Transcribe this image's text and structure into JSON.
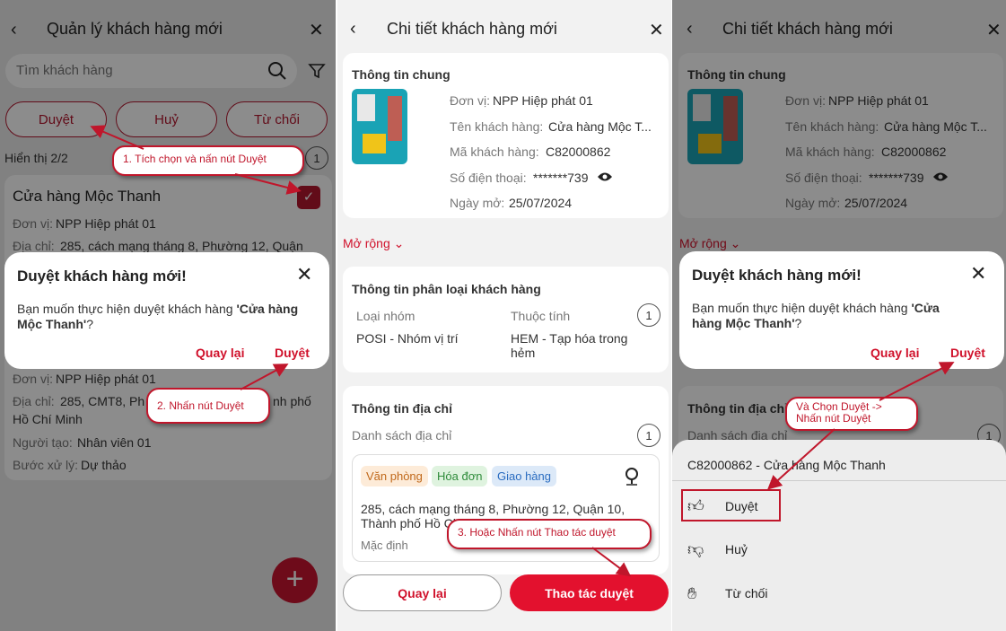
{
  "p1": {
    "title": "Quản lý khách hàng mới",
    "search_placeholder": "Tìm khách hàng",
    "filter_buttons": [
      "Duyệt",
      "Huỷ",
      "Từ chối"
    ],
    "showing": "Hiển thị 2/2",
    "showing_badge": "1",
    "customer_name": "Cửa hàng Mộc Thanh",
    "unit_label": "Đơn vị:",
    "unit_value": "NPP Hiệp phát 01",
    "address_label": "Địa chỉ:",
    "address_value": "285, cách mạng tháng 8, Phường 12, Quận",
    "unit2_label": "Đơn vị:",
    "unit2_value": "NPP Hiệp phát 01",
    "address2_label": "Địa chỉ:",
    "address2_value_a": "285, CMT8, Ph",
    "address2_value_b": "nh phố",
    "address2_value_c": "Hồ Chí Minh",
    "creator_label": "Người tạo:",
    "creator_value": "Nhân viên 01",
    "step_label": "Bước xử lý:",
    "step_value": "Dự thảo",
    "add_symbol": "+",
    "dialog": {
      "title": "Duyệt khách hàng mới!",
      "body_prefix": "Bạn muốn thực hiện duyệt khách hàng ",
      "body_name": "'Cửa hàng Mộc Thanh'",
      "body_suffix": "?",
      "back": "Quay lại",
      "approve": "Duyệt"
    },
    "callout1": "1. Tích chọn và nấn nút Duyệt",
    "callout2": "2. Nhấn nút Duyệt"
  },
  "p2": {
    "title": "Chi tiết khách hàng mới",
    "general_title": "Thông tin chung",
    "rows": [
      {
        "label": "Đơn vị:",
        "value": "NPP Hiệp phát 01"
      },
      {
        "label": "Tên khách hàng:",
        "value": "Cửa hàng Mộc T..."
      },
      {
        "label": "Mã khách hàng:",
        "value": "C82000862"
      },
      {
        "label": "Số điện thoại:",
        "value": "*******739"
      },
      {
        "label": "Ngày mở:",
        "value": "25/07/2024"
      }
    ],
    "expand": "Mở rộng",
    "class_title": "Thông tin phân loại khách hàng",
    "group_label": "Loại nhóm",
    "group_value": "POSI - Nhóm vị trí",
    "attr_label": "Thuộc tính",
    "attr_value_a": "HEM - Tạp hóa trong",
    "attr_value_b": "hẻm",
    "class_badge": "1",
    "addr_title": "Thông tin địa chỉ",
    "addr_list": "Danh sách địa chỉ",
    "addr_badge": "1",
    "tags": [
      "Văn phòng",
      "Hóa đơn",
      "Giao hàng"
    ],
    "addr_line1": "285, cách mạng tháng 8, Phường 12, Quận 10,",
    "addr_line2": "Thành phố Hồ Chí Minh",
    "addr_default": "Mặc định",
    "btn_back": "Quay lại",
    "btn_action": "Thao tác duyệt",
    "callout3": "3. Hoặc Nhấn nút Thao tác duyệt"
  },
  "p3": {
    "title": "Chi tiết khách hàng mới",
    "general_title": "Thông tin chung",
    "rows": [
      {
        "label": "Đơn vị:",
        "value": "NPP Hiệp phát 01"
      },
      {
        "label": "Tên khách hàng:",
        "value": "Cửa hàng Mộc T..."
      },
      {
        "label": "Mã khách hàng:",
        "value": "C82000862"
      },
      {
        "label": "Số điện thoại:",
        "value": "*******739"
      },
      {
        "label": "Ngày mở:",
        "value": "25/07/2024"
      }
    ],
    "expand": "Mở rộng",
    "addr_title": "Thông tin địa chỉ",
    "addr_list": "Danh sách địa chỉ",
    "addr_badge": "1",
    "dialog": {
      "title": "Duyệt khách hàng mới!",
      "body_prefix": "Bạn muốn thực hiện duyệt khách hàng ",
      "body_name_a": "'Cửa",
      "body_name_b": "hàng Mộc Thanh'",
      "body_suffix": "?",
      "back": "Quay lại",
      "approve": "Duyệt"
    },
    "sheet_title": "C82000862 - Cửa hàng Mộc Thanh",
    "sheet_items": [
      "Duyệt",
      "Huỷ",
      "Từ chối"
    ],
    "callout4_a": "Và Chọn Duyệt ->",
    "callout4_b": "Nhấn nút Duyệt"
  },
  "colors": {
    "accent": "#d0112b",
    "callout_border": "#c0162b",
    "dim_overlay": "rgba(0,0,0,0.45)"
  }
}
